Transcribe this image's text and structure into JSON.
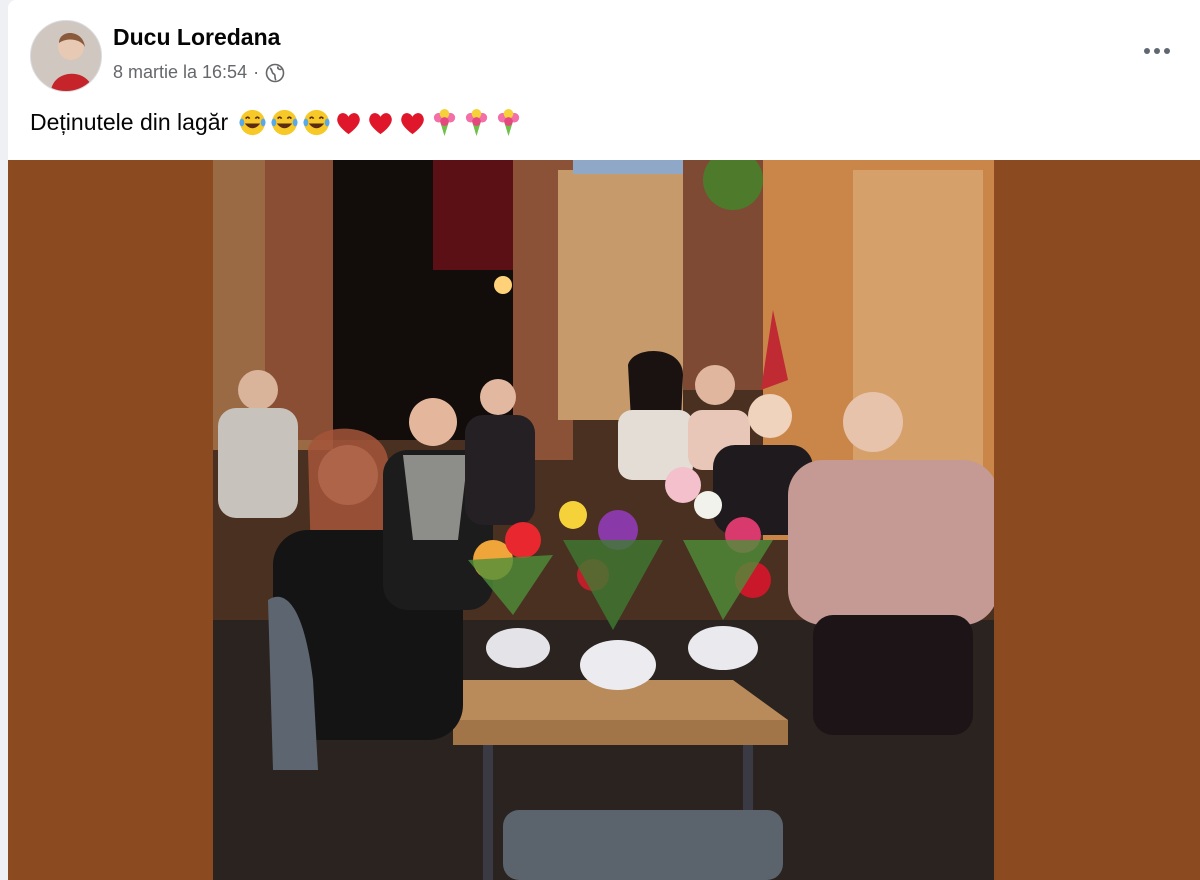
{
  "post": {
    "author": "Ducu Loredana",
    "date": "8 martie la 16:54",
    "separator": "·",
    "privacy_icon": "globe-icon",
    "more_icon": "more-options-icon",
    "caption_text": "Deținutele din lagăr",
    "caption_emojis": [
      "joy-face",
      "joy-face",
      "joy-face",
      "red-heart",
      "red-heart",
      "red-heart",
      "bouquet",
      "bouquet",
      "bouquet"
    ]
  },
  "colors": {
    "media_background": "#8b4a1f",
    "text_primary": "#050505",
    "text_secondary": "#65676b"
  }
}
